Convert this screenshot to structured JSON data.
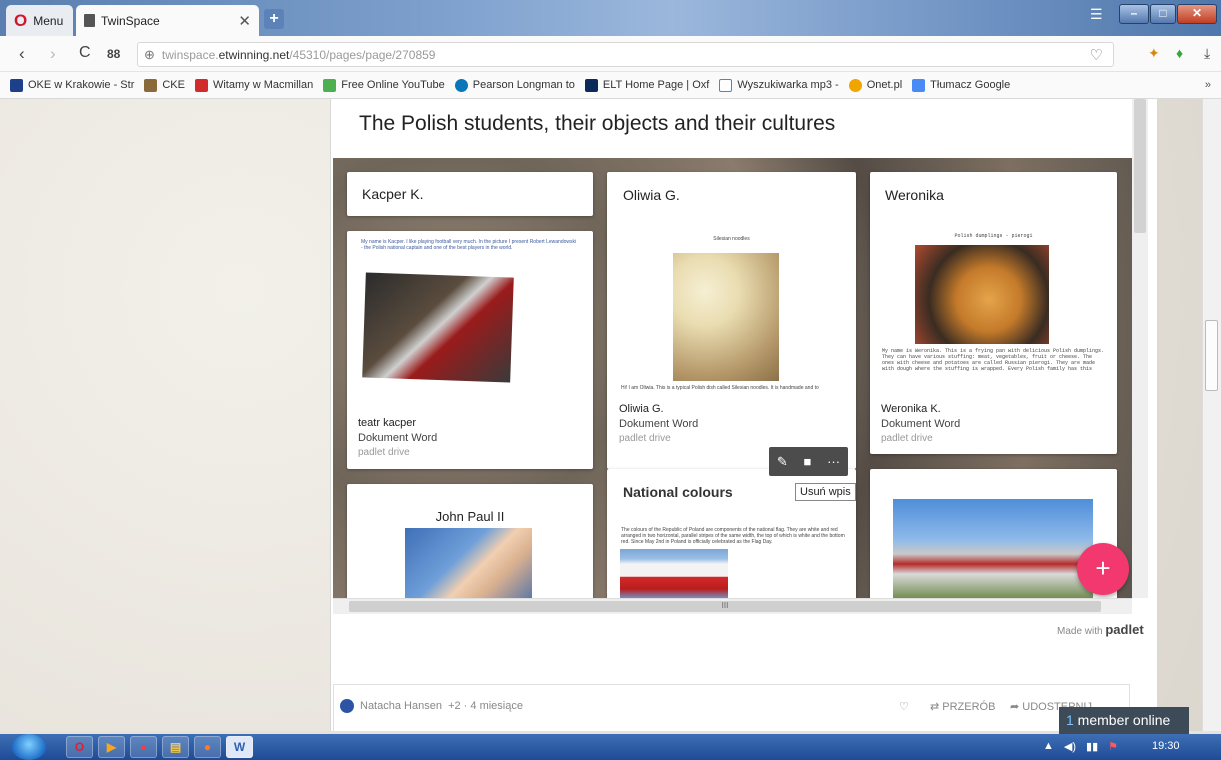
{
  "browser": {
    "menu_label": "Menu",
    "tab_title": "TwinSpace",
    "url_prefix": "twinspace.",
    "url_domain": "etwinning.net",
    "url_path": "/45310/pages/page/270859"
  },
  "bookmarks": [
    {
      "label": "OKE w Krakowie - Str",
      "color": "#1e3f8a"
    },
    {
      "label": "CKE",
      "color": "#8a6a3a"
    },
    {
      "label": "Witamy w Macmillan",
      "color": "#d12b2b"
    },
    {
      "label": "Free Online YouTube",
      "color": "#4caf50"
    },
    {
      "label": "Pearson Longman to",
      "color": "#0b76b8"
    },
    {
      "label": "ELT Home Page | Oxf",
      "color": "#0a2a5a"
    },
    {
      "label": "Wyszukiwarka mp3 -",
      "color": "#3c8bd9"
    },
    {
      "label": "Onet.pl",
      "color": "#f0a500"
    },
    {
      "label": "Tłumacz Google",
      "color": "#4a8af4"
    }
  ],
  "bookmarks_more": "»",
  "padlet": {
    "title": "The Polish students, their objects and their cultures",
    "made_with_prefix": "Made with",
    "made_with_brand": "padlet",
    "fab_symbol": "+",
    "scroll_label": "III",
    "tooltip": "Usuń wpis",
    "cards": [
      {
        "title": "Kacper K.",
        "text": "My name is Kacper. I like playing football very much. In the picture I present Robert Lewandowski - the Polish national captain and one of the best players in the world.",
        "caption": "teatr kacper",
        "doc_type": "Dokument Word",
        "source": "padlet drive"
      },
      {
        "title": "Oliwia G.",
        "doc_heading": "Silesian noodles",
        "text": "Hi! I am Oliwia. This is a typical Polish dish called Silesian noodles. It is handmade and to",
        "caption": "Oliwia G.",
        "doc_type": "Dokument Word",
        "source": "padlet drive"
      },
      {
        "title": "Weronika",
        "doc_heading": "Polish dumplings - pierogi",
        "text": "My name is Weronika. This is a frying pan with delicious Polish dumplings. They can have various stuffing: meat, vegetables, fruit or cheese. The ones with cheese and potatoes are called Russian pierogi. They are made with dough where the stuffing is wrapped. Every Polish family has this",
        "caption": "Weronika K.",
        "doc_type": "Dokument Word",
        "source": "padlet drive"
      },
      {
        "title": "John Paul II"
      },
      {
        "title": "National colours",
        "text": "The colours of the Republic of Poland are components of the national flag. They are white and red arranged in two horizontal, parallel stripes of the same width, the top of which is white and the bottom red. Since May 2nd in Poland is officially celebrated as the Flag Day."
      },
      {
        "title": ""
      }
    ]
  },
  "comment_bar": {
    "author": "Natacha Hansen",
    "plus": "+2",
    "time": "4 miesiące",
    "remake": "PRZERÓB",
    "share": "UDOSTĘPNIJ"
  },
  "member_online": {
    "count": "1",
    "label": " member online"
  },
  "taskbar": {
    "time": "19:30"
  }
}
